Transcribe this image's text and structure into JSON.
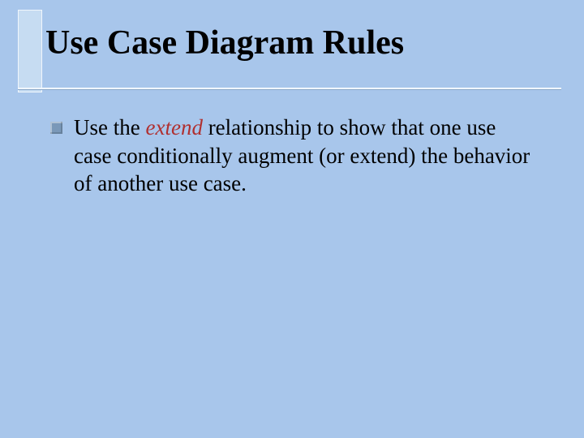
{
  "slide": {
    "title": "Use Case Diagram Rules",
    "bullets": [
      {
        "pre": "Use the ",
        "emph": "extend",
        "post": " relationship to show that one use case conditionally augment (or extend) the behavior of another use case."
      }
    ],
    "colors": {
      "background": "#a8c6eb",
      "accent_fill": "#c6dcf2",
      "bullet_fill": "#7a98b8",
      "emph_color": "#b03030"
    }
  }
}
